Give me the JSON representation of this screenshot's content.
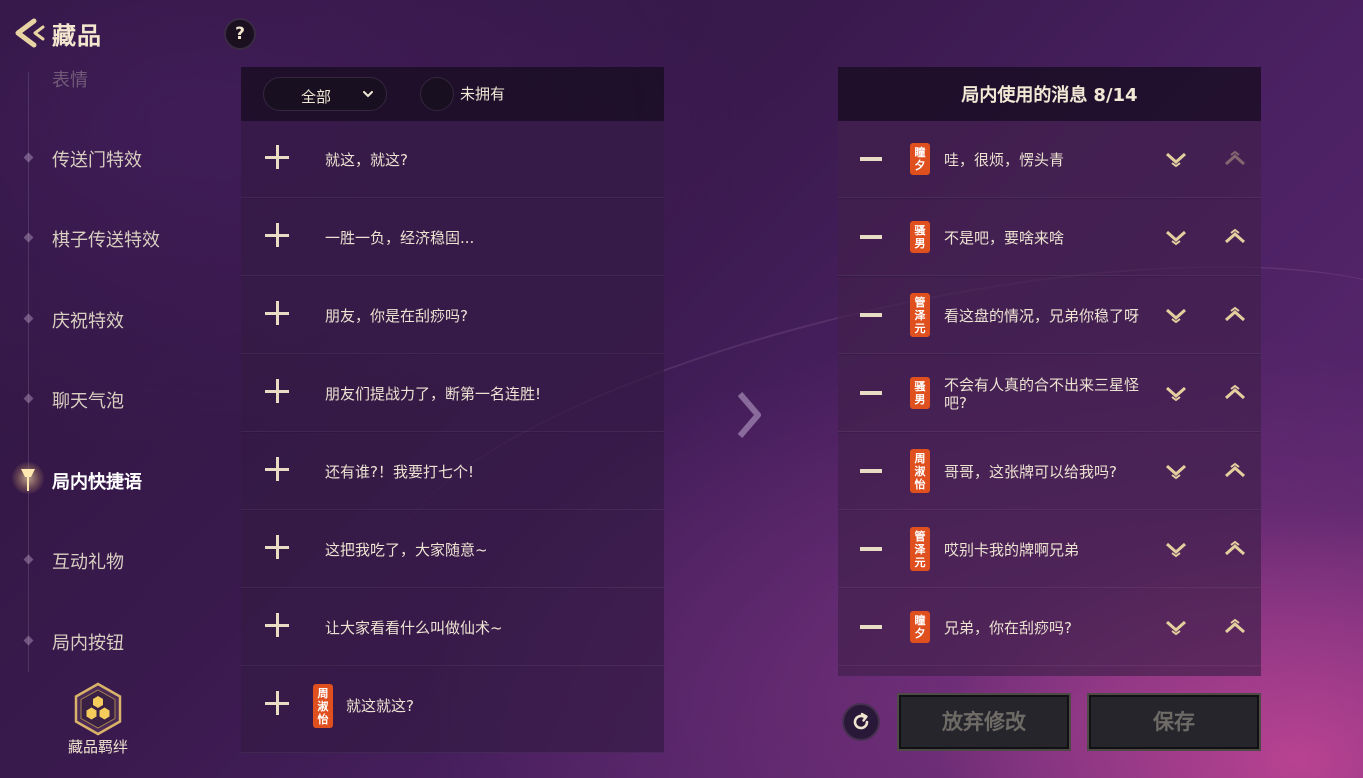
{
  "header": {
    "title": "藏品",
    "help_label": "?"
  },
  "sidebar": {
    "items": [
      {
        "label": "表情",
        "state": "faded"
      },
      {
        "label": "传送门特效",
        "state": "normal"
      },
      {
        "label": "棋子传送特效",
        "state": "normal"
      },
      {
        "label": "庆祝特效",
        "state": "normal"
      },
      {
        "label": "聊天气泡",
        "state": "normal"
      },
      {
        "label": "局内快捷语",
        "state": "active"
      },
      {
        "label": "互动礼物",
        "state": "normal"
      },
      {
        "label": "局内按钮",
        "state": "normal"
      }
    ],
    "bond_label": "藏品羁绊"
  },
  "library": {
    "filter_selected": "全部",
    "unowned_label": "未拥有",
    "rows": [
      {
        "text": "就这，就这?"
      },
      {
        "text": "一胜一负，经济稳固..."
      },
      {
        "text": "朋友，你是在刮痧吗?"
      },
      {
        "text": "朋友们提战力了，断第一名连胜!"
      },
      {
        "text": "还有谁?！我要打七个!"
      },
      {
        "text": "这把我吃了，大家随意~"
      },
      {
        "text": "让大家看看什么叫做仙术~"
      },
      {
        "text": "就这就这?",
        "badge": [
          "周",
          "淑",
          "怡"
        ]
      }
    ]
  },
  "selected": {
    "title": "局内使用的消息",
    "count": "8/14",
    "rows": [
      {
        "badge": [
          "瞳",
          "夕"
        ],
        "text": "哇，很烦，愣头青",
        "up_disabled": true
      },
      {
        "badge": [
          "骚",
          "男"
        ],
        "text": "不是吧，要啥来啥"
      },
      {
        "badge": [
          "管",
          "泽",
          "元"
        ],
        "text": "看这盘的情况，兄弟你稳了呀"
      },
      {
        "badge": [
          "骚",
          "男"
        ],
        "text": "不会有人真的合不出来三星怪吧?"
      },
      {
        "badge": [
          "周",
          "淑",
          "怡"
        ],
        "text": "哥哥，这张牌可以给我吗?"
      },
      {
        "badge": [
          "管",
          "泽",
          "元"
        ],
        "text": "哎别卡我的牌啊兄弟"
      },
      {
        "badge": [
          "瞳",
          "夕"
        ],
        "text": "兄弟，你在刮痧吗?"
      }
    ]
  },
  "actions": {
    "discard_label": "放弃修改",
    "save_label": "保存"
  },
  "colors": {
    "accent_gold": "#e8d3a2",
    "badge_orange": "#e0501f",
    "button_disabled_text": "#6e6a66"
  }
}
